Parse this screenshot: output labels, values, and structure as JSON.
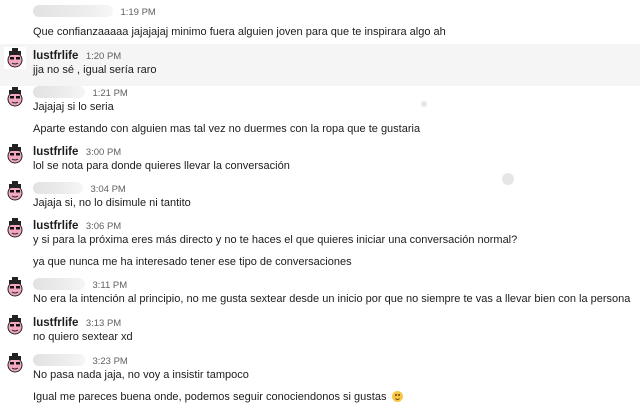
{
  "messages": [
    {
      "user": "",
      "time": "1:19 PM",
      "lines": [
        "Que confianzaaaaa jajajajaj minimo fuera alguien joven para que te inspirara algo ah"
      ]
    },
    {
      "user": "lustfrlife",
      "time": "1:20 PM",
      "lines": [
        "jja no sé , igual sería raro"
      ]
    },
    {
      "user": "",
      "time": "1:21 PM",
      "lines": [
        "Jajajaj si lo seria",
        "Aparte estando con alguien mas tal vez no duermes con la ropa que te gustaria"
      ]
    },
    {
      "user": "lustfrlife",
      "time": "3:00 PM",
      "lines": [
        "lol se nota para donde quieres llevar la conversación"
      ]
    },
    {
      "user": "",
      "time": "3:04 PM",
      "lines": [
        "Jajaja si, no lo disimule ni tantito"
      ]
    },
    {
      "user": "lustfrlife",
      "time": "3:06 PM",
      "lines": [
        "y si para la próxima eres más directo y no te haces el que quieres iniciar una conversación normal?",
        "ya que nunca me ha interesado tener ese tipo de conversaciones"
      ]
    },
    {
      "user": "",
      "time": "3:11 PM",
      "lines": [
        "No era la intención al principio, no me gusta sextear desde un inicio por que no siempre te vas a llevar bien con la persona"
      ]
    },
    {
      "user": "lustfrlife",
      "time": "3:13 PM",
      "lines": [
        "no quiero sextear xd"
      ]
    },
    {
      "user": "",
      "time": "3:23 PM",
      "lines": [
        "No pasa nada jaja, no voy a insistir tampoco",
        "Igual me pareces buena onde, podemos seguir conociendonos si gustas"
      ]
    }
  ],
  "emoji": "smiling-face-emoji",
  "colors": {
    "text": "#1d1c1d",
    "timestamp": "#616061",
    "highlight": "#f5f5f5",
    "avatar_pink": "#f4a7c3"
  }
}
